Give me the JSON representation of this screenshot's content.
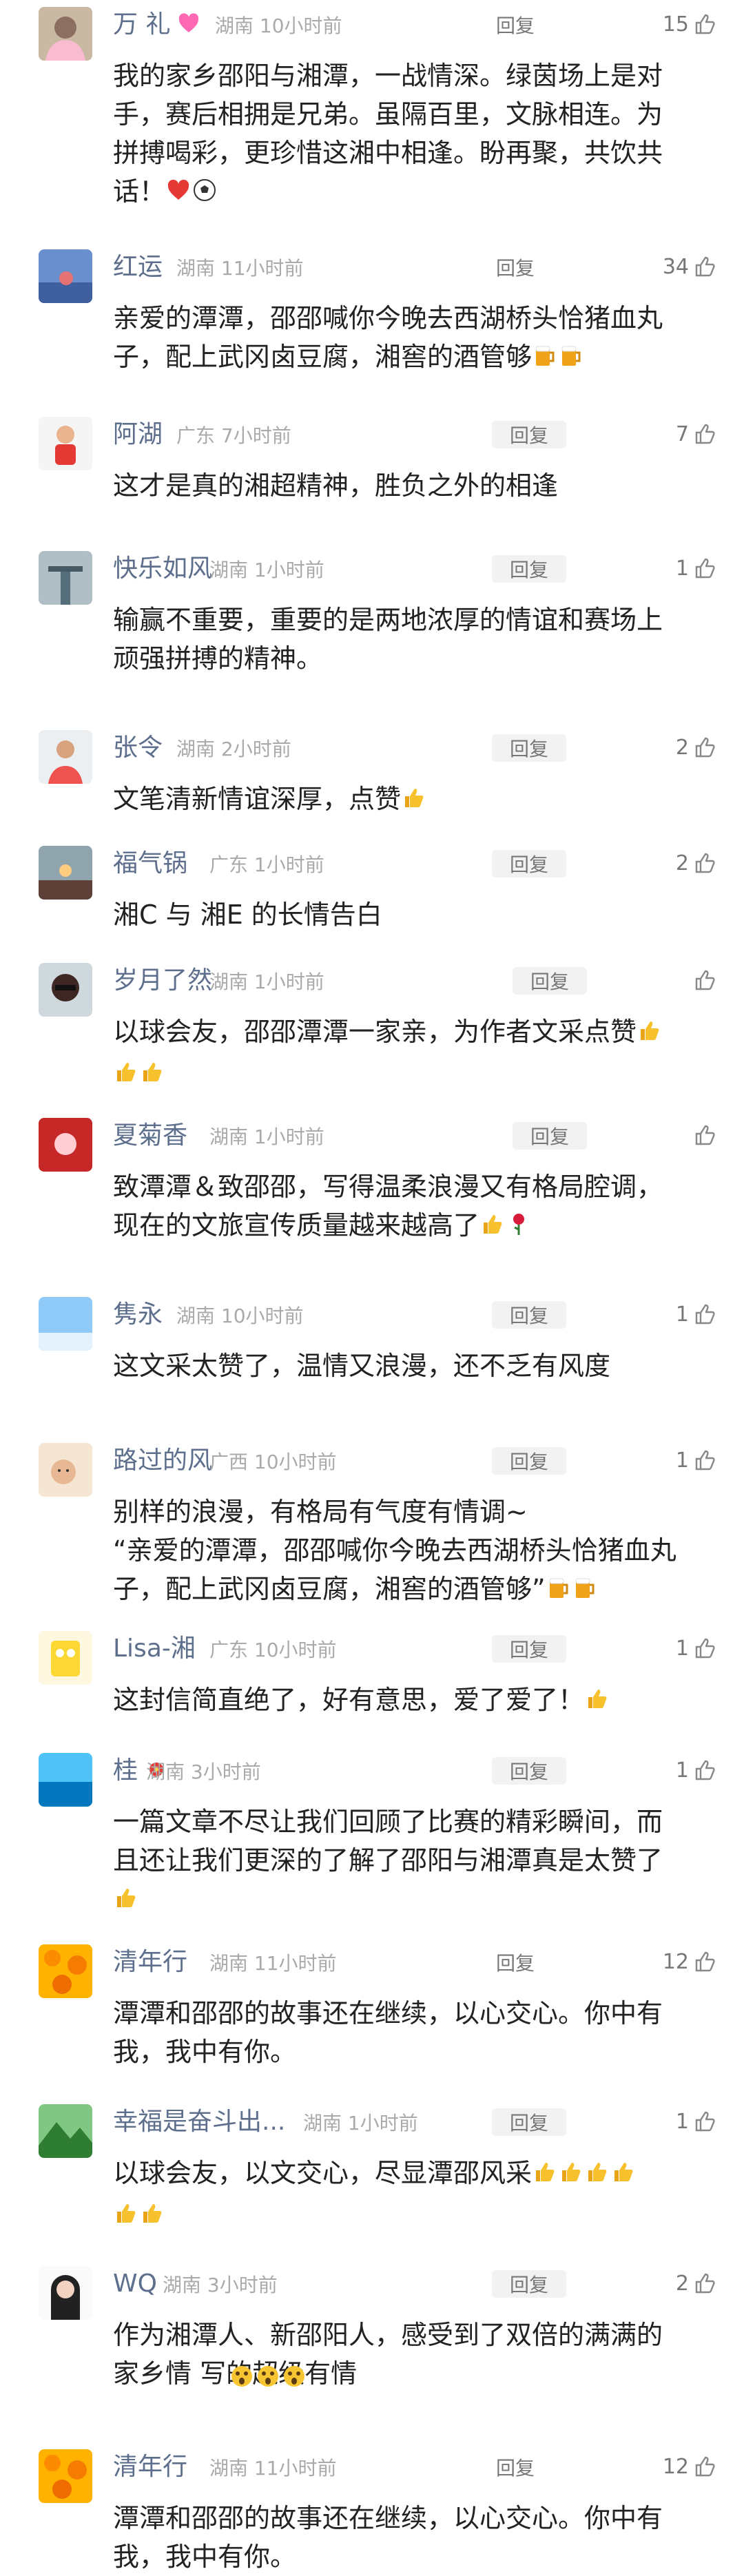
{
  "reply_label": "回复",
  "colors": {
    "name": "#5d6f8c",
    "meta": "#aaaaaa",
    "text": "#222222",
    "reply_bg": "#f2f2f2"
  },
  "comments": [
    {
      "name": "万 礼",
      "name_badge": "heart-emoji",
      "location": "湖南",
      "time": "10小时前",
      "likes": "15",
      "lines": [
        "我的家乡邵阳与湘潭，一战情深。绿茵场上是对",
        "手，赛后相拥是兄弟。虽隔百里，文脉相连。为",
        "拼搏喝彩，更珍惜这湘中相逢。盼再聚，共饮共",
        "话！"
      ],
      "trailing_emoji": [
        "heart",
        "soccer"
      ],
      "avatar": "avatar-sakura"
    },
    {
      "name": "红运",
      "location": "湖南",
      "time": "11小时前",
      "likes": "34",
      "lines": [
        "亲爱的潭潭，邵邵喊你今晚去西湖桥头恰猪血丸",
        "子，配上武冈卤豆腐，湘窖的酒管够"
      ],
      "trailing_emoji": [
        "beer",
        "beer"
      ],
      "avatar": "avatar-sunset"
    },
    {
      "name": "阿湖",
      "location": "广东",
      "time": "7小时前",
      "likes": "7",
      "lines": [
        "这才是真的湘超精神，胜负之外的相逢"
      ],
      "avatar": "avatar-kid"
    },
    {
      "name": "快乐如风",
      "location": "湖南",
      "time": "1小时前",
      "likes": "1",
      "lines": [
        "输赢不重要，重要的是两地浓厚的情谊和赛场上",
        "顽强拼搏的精神。"
      ],
      "avatar": "avatar-tower"
    },
    {
      "name": "张令",
      "location": "湖南",
      "time": "2小时前",
      "likes": "2",
      "lines": [
        "文笔清新情谊深厚，点赞"
      ],
      "trailing_emoji": [
        "thumb"
      ],
      "avatar": "avatar-person"
    },
    {
      "name": "福气锅",
      "location": "广东",
      "time": "1小时前",
      "likes": "2",
      "lines": [
        "湘C 与 湘E 的长情告白"
      ],
      "avatar": "avatar-street"
    },
    {
      "name": "岁月了然",
      "location": "湖南",
      "time": "1小时前",
      "likes": "",
      "lines": [
        "以球会友，邵邵潭潭一家亲，为作者文采点赞",
        ""
      ],
      "line_emoji": [
        [
          "thumb"
        ],
        [
          "thumb",
          "thumb"
        ]
      ],
      "avatar": "avatar-glasses"
    },
    {
      "name": "夏菊香",
      "location": "湖南",
      "time": "1小时前",
      "likes": "",
      "lines": [
        "致潭潭＆致邵邵，写得温柔浪漫又有格局腔调，",
        "现在的文旅宣传质量越来越高了"
      ],
      "trailing_emoji": [
        "thumb",
        "rose"
      ],
      "avatar": "avatar-red"
    },
    {
      "name": "隽永",
      "location": "湖南",
      "time": "10小时前",
      "likes": "1",
      "lines": [
        "这文采太赞了，温情又浪漫，还不乏有风度"
      ],
      "avatar": "avatar-sky"
    },
    {
      "name": "路过的风",
      "location": "广西",
      "time": "10小时前",
      "likes": "1",
      "lines": [
        "别样的浪漫，有格局有气度有情调~",
        "“亲爱的潭潭，邵邵喊你今晚去西湖桥头恰猪血丸",
        "子，配上武冈卤豆腐，湘窖的酒管够”"
      ],
      "line_emoji": [
        [],
        [],
        [
          "beer",
          "beer"
        ]
      ],
      "avatar": "avatar-baby"
    },
    {
      "name": "Lisa-湘",
      "location": "广东",
      "time": "10小时前",
      "likes": "1",
      "lines": [
        "这封信简直绝了，好有意思，爱了爱了！"
      ],
      "trailing_emoji": [
        "thumb"
      ],
      "avatar": "avatar-sponge"
    },
    {
      "name": "桂",
      "name_badge": "hibiscus-emoji",
      "location": "湖南",
      "time": "3小时前",
      "likes": "1",
      "lines": [
        "一篇文章不尽让我们回顾了比赛的精彩瞬间，而",
        "且还让我们更深的了解了邵阳与湘潭真是太赞了",
        ""
      ],
      "line_emoji": [
        [],
        [],
        [
          "thumb"
        ]
      ],
      "avatar": "avatar-sea"
    },
    {
      "name": "清年行",
      "location": "湖南",
      "time": "11小时前",
      "likes": "12",
      "lines": [
        "潭潭和邵邵的故事还在继续，以心交心。你中有",
        "我，我中有你。"
      ],
      "avatar": "avatar-orange"
    },
    {
      "name": "幸福是奋斗出...",
      "location": "湖南",
      "time": "1小时前",
      "likes": "1",
      "lines": [
        "以球会友，以文交心，尽显潭邵风采",
        ""
      ],
      "line_emoji": [
        [
          "thumb",
          "thumb",
          "thumb",
          "thumb"
        ],
        [
          "thumb",
          "thumb"
        ]
      ],
      "avatar": "avatar-mountain"
    },
    {
      "name": "WQ",
      "location": "湖南",
      "time": "3小时前",
      "likes": "2",
      "lines": [
        "作为湘潭人、新邵阳人，感受到了双倍的满满的",
        "家乡情          写的超级有情"
      ],
      "line_emoji": [
        [],
        []
      ],
      "mid_emoji": [
        "wow",
        "wow",
        "wow"
      ],
      "avatar": "avatar-girl"
    },
    {
      "name": "清年行",
      "location": "湖南",
      "time": "11小时前",
      "likes": "12",
      "lines": [
        "潭潭和邵邵的故事还在继续，以心交心。你中有",
        "我，我中有你。"
      ],
      "avatar": "avatar-orange"
    }
  ]
}
